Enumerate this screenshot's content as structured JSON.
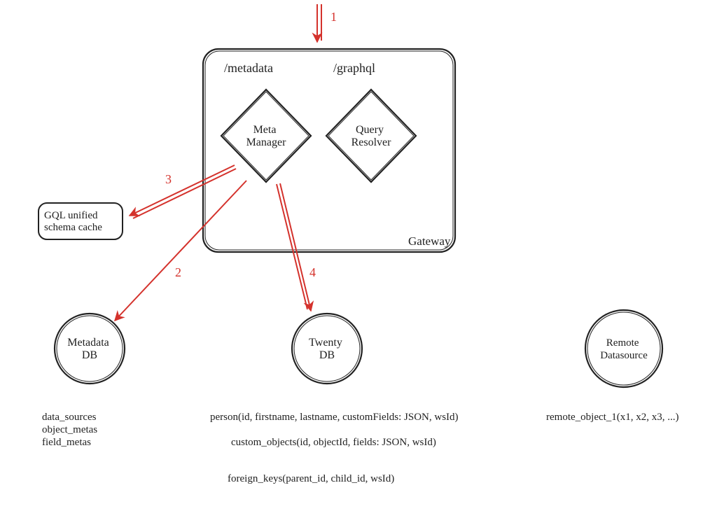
{
  "gateway": {
    "container_label": "Gateway",
    "endpoints": {
      "metadata": "/metadata",
      "graphql": "/graphql"
    },
    "nodes": {
      "meta_manager": "Meta\nManager",
      "query_resolver": "Query\nResolver"
    }
  },
  "cache": {
    "gql_unified": "GQL unified\nschema cache"
  },
  "databases": {
    "metadata_db": "Metadata\nDB",
    "twenty_db": "Twenty\nDB",
    "remote_datasource": "Remote\nDatasource"
  },
  "schemas": {
    "metadata_db": "data_sources\nobject_metas\nfield_metas",
    "twenty_db_person": "person(id, firstname, lastname, customFields: JSON, wsId)",
    "twenty_db_custom": "custom_objects(id, objectId, fields: JSON, wsId)",
    "twenty_db_fk": "foreign_keys(parent_id, child_id, wsId)",
    "remote": "remote_object_1(x1, x2, x3, ...)"
  },
  "arrows": {
    "a1": "1",
    "a2": "2",
    "a3": "3",
    "a4": "4"
  },
  "colors": {
    "arrow": "#d4322c",
    "line": "#222222"
  }
}
